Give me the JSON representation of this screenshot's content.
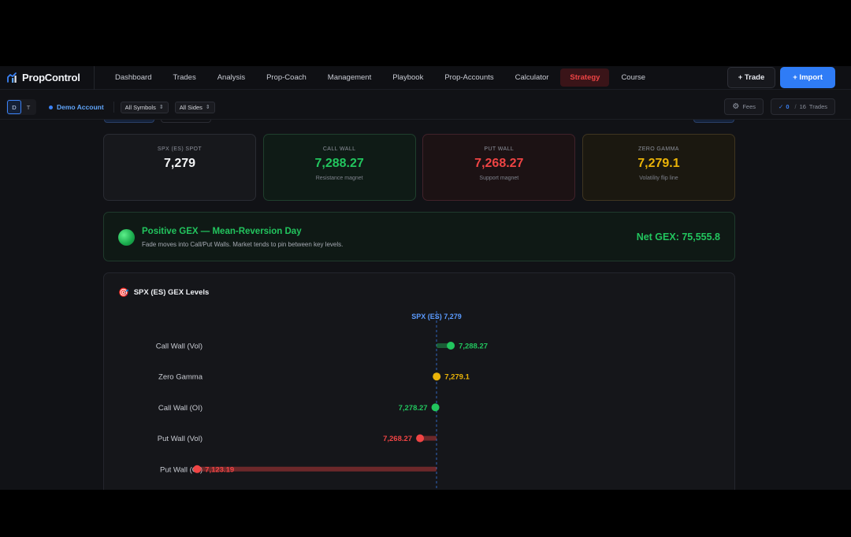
{
  "brand": {
    "name": "PropControl",
    "icon": "propcontrol-logo-icon"
  },
  "nav": {
    "items": [
      {
        "label": "Dashboard",
        "active": false
      },
      {
        "label": "Trades",
        "active": false
      },
      {
        "label": "Analysis",
        "active": false
      },
      {
        "label": "Prop-Coach",
        "active": false
      },
      {
        "label": "Management",
        "active": false
      },
      {
        "label": "Playbook",
        "active": false
      },
      {
        "label": "Prop-Accounts",
        "active": false
      },
      {
        "label": "Calculator",
        "active": false
      },
      {
        "label": "Strategy",
        "active": true
      },
      {
        "label": "Course",
        "active": false
      }
    ],
    "trade_button": "+ Trade",
    "import_button": "+ Import"
  },
  "subbar": {
    "toggle": [
      "D",
      "T"
    ],
    "account": "Demo Account",
    "symbols_select": "All Symbols",
    "sides_select": "All Sides",
    "fees_label": "Fees",
    "trades_checked": "0",
    "trades_total": "16",
    "trades_label": "Trades"
  },
  "cards": [
    {
      "label": "SPX (ES) SPOT",
      "value": "7,279",
      "sub": ""
    },
    {
      "label": "CALL WALL",
      "value": "7,288.27",
      "sub": "Resistance magnet"
    },
    {
      "label": "PUT WALL",
      "value": "7,268.27",
      "sub": "Support magnet"
    },
    {
      "label": "ZERO GAMMA",
      "value": "7,279.1",
      "sub": "Volatility flip line"
    }
  ],
  "regime": {
    "title": "Positive GEX — Mean-Reversion Day",
    "description": "Fade moves into Call/Put Walls. Market tends to pin between key levels.",
    "net": "Net GEX: 75,555.8"
  },
  "levels_panel": {
    "title": "SPX (ES) GEX Levels",
    "icon": "target-icon"
  },
  "colors": {
    "call": "#22c55e",
    "put": "#ef4444",
    "zero": "#eab308",
    "spot": "#3b82f6",
    "accent": "#2f7cf6"
  },
  "chart_data": {
    "type": "scatter",
    "spot_label": "SPX (ES) 7,279",
    "spot": 7279,
    "levels": [
      {
        "name": "Call Wall (Vol)",
        "value": 7288.27,
        "label": "7,288.27",
        "kind": "call"
      },
      {
        "name": "Zero Gamma",
        "value": 7279.1,
        "label": "7,279.1",
        "kind": "zero"
      },
      {
        "name": "Call Wall (OI)",
        "value": 7278.27,
        "label": "7,278.27",
        "kind": "call"
      },
      {
        "name": "Put Wall (Vol)",
        "value": 7268.27,
        "label": "7,268.27",
        "kind": "put"
      },
      {
        "name": "Put Wall (OI)",
        "value": 7123.19,
        "label": "7,123.19",
        "kind": "put"
      }
    ]
  }
}
